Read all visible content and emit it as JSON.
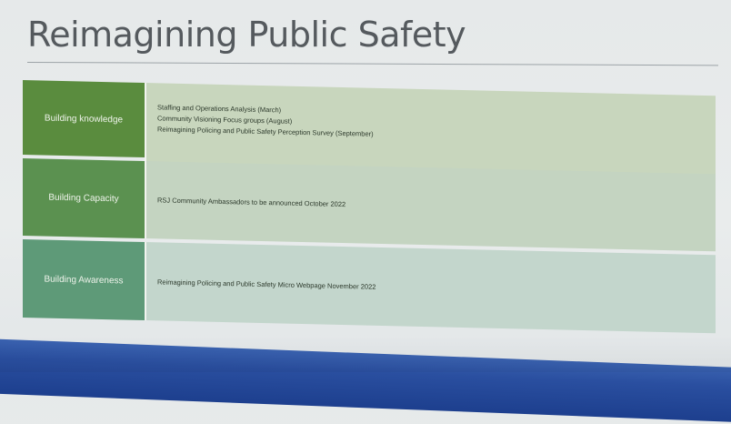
{
  "title": "Reimagining Public Safety",
  "colors": {
    "row1_label": "#5a8c3e",
    "row2_label": "#5b9150",
    "row3_label": "#5e9a78",
    "row1_content": "#c8d6bd",
    "row2_content": "#c4d4c1",
    "row3_content": "#c3d6cc"
  },
  "rows": [
    {
      "label": "Building knowledge",
      "lines": [
        "Staffing and Operations Analysis (March)",
        "Community Visioning Focus groups (August)",
        "Reimagining Policing and Public Safety Perception Survey (September)"
      ]
    },
    {
      "label": "Building Capacity",
      "lines": [
        "RSJ Community Ambassadors to be announced October 2022"
      ]
    },
    {
      "label": "Building Awareness",
      "lines": [
        "Reimagining Policing and Public Safety Micro Webpage November 2022"
      ]
    }
  ]
}
